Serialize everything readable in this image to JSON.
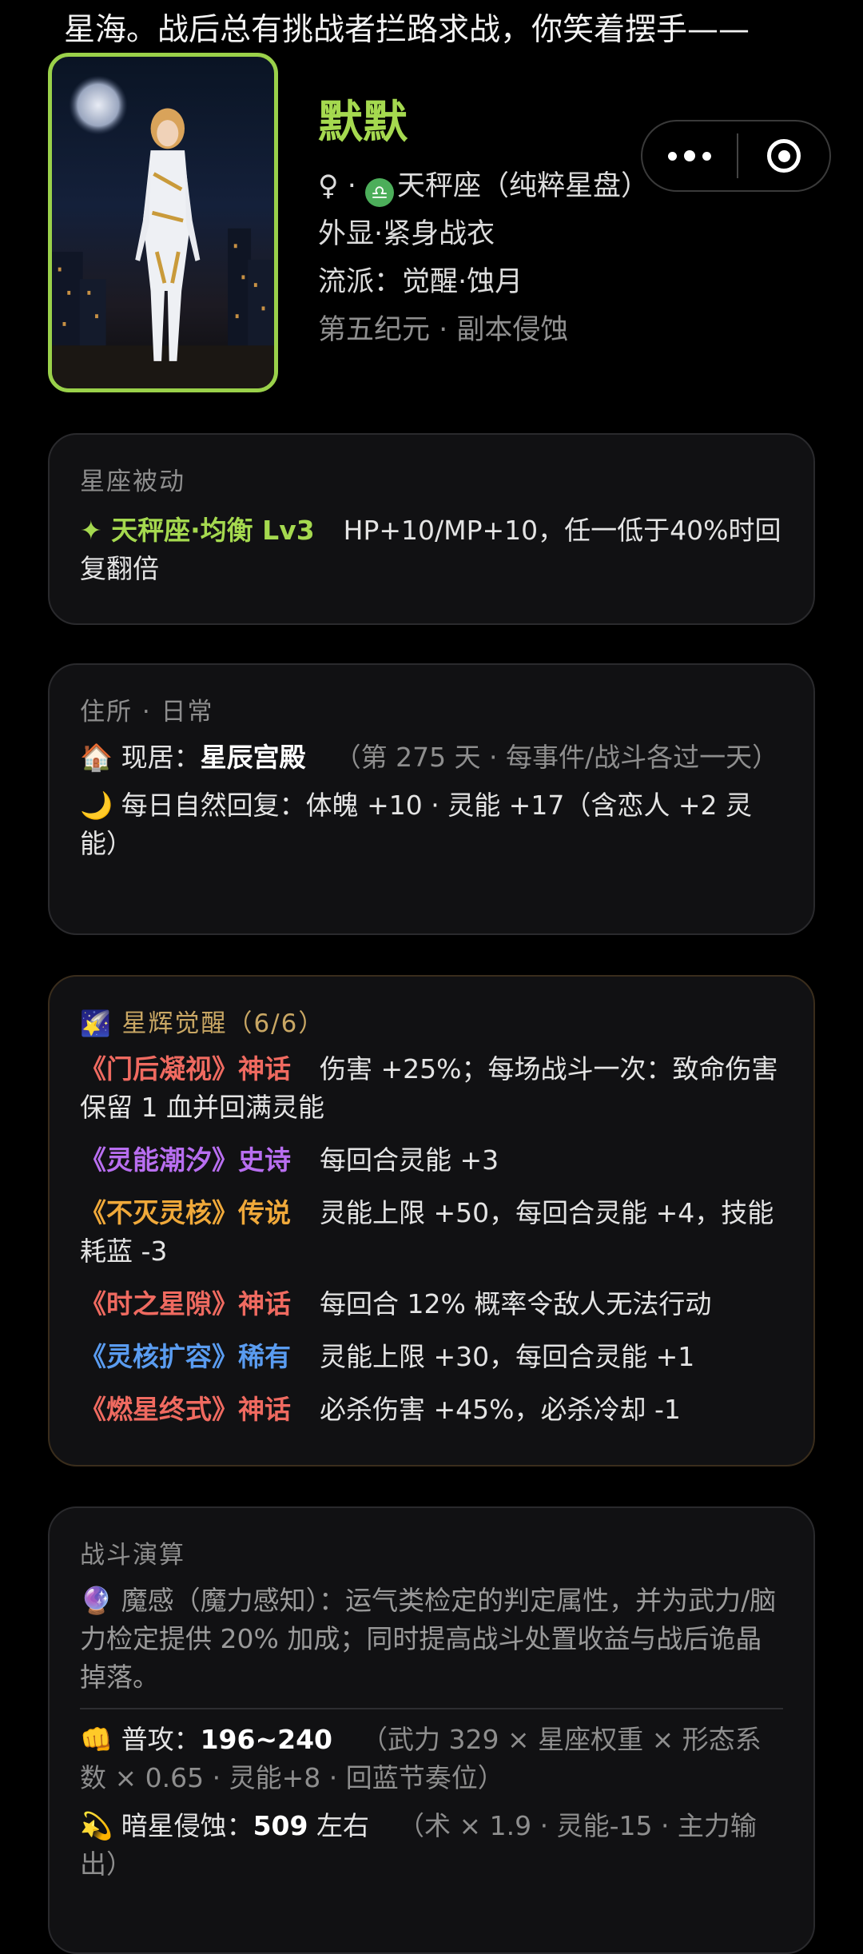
{
  "story": {
    "line": "星海。战后总有挑战者拦路求战，你笑着摆手——"
  },
  "capsule": {
    "more_label": "more",
    "close_label": "close"
  },
  "profile": {
    "name": "默默",
    "gender_symbol": "♀",
    "sep": " · ",
    "zodiac_icon": "♎",
    "zodiac": "天秤座（纯粹星盘）",
    "appearance": "外显·紧身战衣",
    "school": "流派：觉醒·蚀月",
    "era": "第五纪元 · 副本侵蚀"
  },
  "passive": {
    "title": "星座被动",
    "skill_name": "✦ 天秤座·均衡 Lv3",
    "effect": "HP+10/MP+10，任一低于40%时回复翻倍"
  },
  "residence": {
    "title": "住所 · 日常",
    "home_icon": "🏠",
    "home_label": "现居：",
    "home_value": "星辰宫殿",
    "home_note": "（第 275 天 · 每事件/战斗各过一天）",
    "moon_icon": "🌙",
    "recovery": "每日自然回复：体魄 +10 · 灵能 +17（含恋人 +2 灵能）"
  },
  "awakening": {
    "title": "🌠 星辉觉醒（6/6）",
    "items": [
      {
        "name": "《门后凝视》神话",
        "tier": "myth",
        "effect": "伤害 +25%；每场战斗一次：致命伤害保留 1 血并回满灵能"
      },
      {
        "name": "《灵能潮汐》史诗",
        "tier": "epic",
        "effect": "每回合灵能 +3"
      },
      {
        "name": "《不灭灵核》传说",
        "tier": "legend",
        "effect": "灵能上限 +50，每回合灵能 +4，技能耗蓝 -3"
      },
      {
        "name": "《时之星隙》神话",
        "tier": "myth",
        "effect": "每回合 12% 概率令敌人无法行动"
      },
      {
        "name": "《灵核扩容》稀有",
        "tier": "rare",
        "effect": "灵能上限 +30，每回合灵能 +1"
      },
      {
        "name": "《燃星终式》神话",
        "tier": "myth",
        "effect": "必杀伤害 +45%，必杀冷却 -1"
      }
    ]
  },
  "battle": {
    "title": "战斗演算",
    "magic_icon": "🔮",
    "magic_text": "魔感（魔力感知）：运气类检定的判定属性，并为武力/脑力检定提供 20% 加成；同时提高战斗处置收益与战后诡晶掉落。",
    "attack_icon": "👊",
    "attack_label": "普攻：",
    "attack_value": "196~240",
    "attack_note": "（武力 329 × 星座权重 × 形态系数 × 0.65 · 灵能+8 · 回蓝节奏位）",
    "erosion_icon": "💫",
    "erosion_label": "暗星侵蚀：",
    "erosion_value": "509",
    "erosion_suffix": " 左右",
    "erosion_note": "（术 × 1.9 · 灵能-15 · 主力输出）"
  }
}
